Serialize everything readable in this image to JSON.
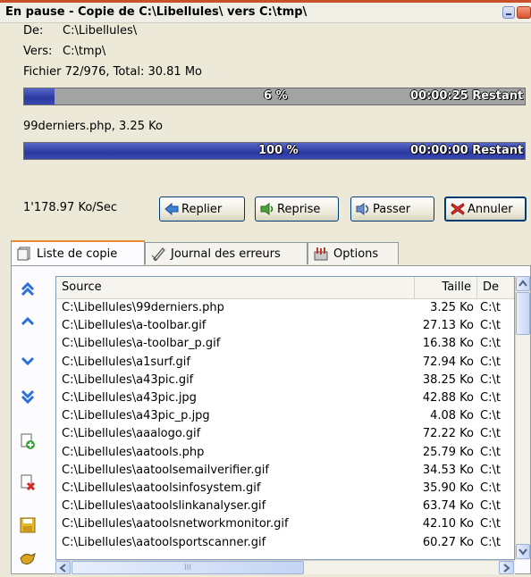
{
  "window": {
    "title": "En pause - Copie de C:\\Libellules\\ vers C:\\tmp\\"
  },
  "info": {
    "from_label": "De:",
    "from_value": "C:\\Libellules\\",
    "to_label": "Vers:",
    "to_value": "C:\\tmp\\",
    "file_counter": "Fichier 72/976, Total: 30.81 Mo",
    "current_file": "99derniers.php, 3.25 Ko",
    "speed": "1'178.97 Ko/Sec"
  },
  "progress_total": {
    "percent_text": "6 %",
    "remaining": "00:00:25 Restant",
    "fraction": 0.06
  },
  "progress_file": {
    "percent_text": "100 %",
    "remaining": "00:00:00 Restant",
    "fraction": 1.0
  },
  "buttons": {
    "replier": "Replier",
    "reprise": "Reprise",
    "passer": "Passer",
    "annuler": "Annuler"
  },
  "tabs": [
    "Liste de copie",
    "Journal des erreurs",
    "Options"
  ],
  "columns": [
    "Source",
    "Taille",
    "De"
  ],
  "rows": [
    {
      "source": "C:\\Libellules\\99derniers.php",
      "size": "3.25 Ko",
      "dest": "C:\\t"
    },
    {
      "source": "C:\\Libellules\\a-toolbar.gif",
      "size": "27.13 Ko",
      "dest": "C:\\t"
    },
    {
      "source": "C:\\Libellules\\a-toolbar_p.gif",
      "size": "16.38 Ko",
      "dest": "C:\\t"
    },
    {
      "source": "C:\\Libellules\\a1surf.gif",
      "size": "72.94 Ko",
      "dest": "C:\\t"
    },
    {
      "source": "C:\\Libellules\\a43pic.gif",
      "size": "38.25 Ko",
      "dest": "C:\\t"
    },
    {
      "source": "C:\\Libellules\\a43pic.jpg",
      "size": "42.88 Ko",
      "dest": "C:\\t"
    },
    {
      "source": "C:\\Libellules\\a43pic_p.jpg",
      "size": "4.08 Ko",
      "dest": "C:\\t"
    },
    {
      "source": "C:\\Libellules\\aaalogo.gif",
      "size": "72.22 Ko",
      "dest": "C:\\t"
    },
    {
      "source": "C:\\Libellules\\aatools.php",
      "size": "25.79 Ko",
      "dest": "C:\\t"
    },
    {
      "source": "C:\\Libellules\\aatoolsemailverifier.gif",
      "size": "34.53 Ko",
      "dest": "C:\\t"
    },
    {
      "source": "C:\\Libellules\\aatoolsinfosystem.gif",
      "size": "35.90 Ko",
      "dest": "C:\\t"
    },
    {
      "source": "C:\\Libellules\\aatoolslinkanalyser.gif",
      "size": "63.74 Ko",
      "dest": "C:\\t"
    },
    {
      "source": "C:\\Libellules\\aatoolsnetworkmonitor.gif",
      "size": "42.10 Ko",
      "dest": "C:\\t"
    },
    {
      "source": "C:\\Libellules\\aatoolsportscanner.gif",
      "size": "60.27 Ko",
      "dest": "C:\\t"
    }
  ],
  "side_icons": [
    "move-top-icon",
    "move-up-icon",
    "move-down-icon",
    "move-bottom-icon",
    "add-file-icon",
    "remove-file-icon",
    "save-list-icon",
    "load-list-icon"
  ],
  "scroll": {
    "grip": "III"
  },
  "colors": {
    "progress": "#2b39a0",
    "tab_accent": "#e68b2c",
    "title_accent": "#c8502a"
  }
}
